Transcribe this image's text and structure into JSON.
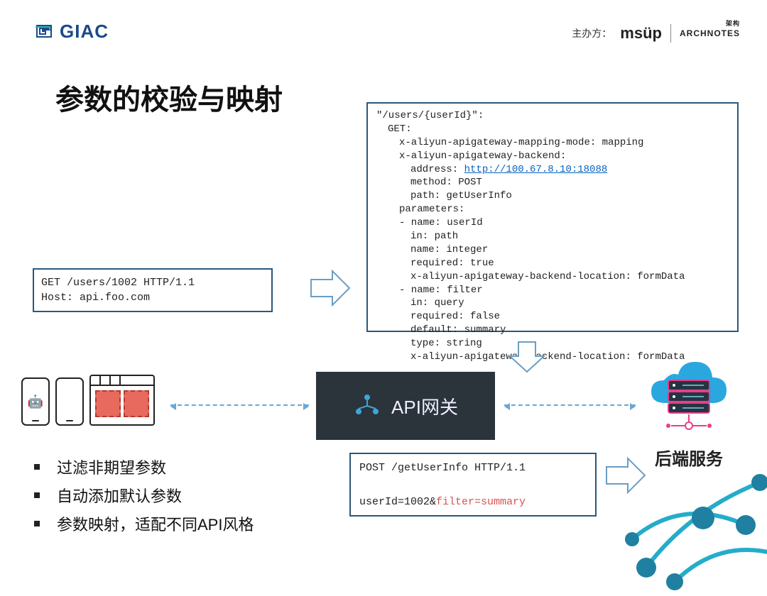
{
  "header": {
    "logo_text": "GIAC",
    "host_label": "主办方：",
    "sponsor1": "msüp",
    "sponsor2": "ARCHNOTES"
  },
  "title": "参数的校验与映射",
  "request_box": {
    "line1": "GET /users/1002 HTTP/1.1",
    "line2": "Host: api.foo.com"
  },
  "config_box": {
    "path_decl": "\"/users/{userId}\":",
    "method": "GET:",
    "mapping_mode": "x-aliyun-apigateway-mapping-mode: mapping",
    "backend_key": "x-aliyun-apigateway-backend:",
    "address_label": "address: ",
    "address_url": "http://100.67.8.10:18088",
    "backend_method": "method: POST",
    "backend_path": "path: getUserInfo",
    "params_key": "parameters:",
    "p1_name": "- name: userId",
    "p1_in": "in: path",
    "p1_type": "name: integer",
    "p1_required": "required: true",
    "p1_loc": "x-aliyun-apigateway-backend-location: formData",
    "p2_name": "- name: filter",
    "p2_in": "in: query",
    "p2_required": "required: false",
    "p2_default": "default: summary",
    "p2_type": "type: string",
    "p2_loc": "x-aliyun-apigateway-backend-location: formData"
  },
  "gateway_label": "API网关",
  "backend_label": "后端服务",
  "response_box": {
    "line1": "POST /getUserInfo HTTP/1.1",
    "line2a": "userId=1002&",
    "line2b": "filter=summary"
  },
  "bullets": {
    "b1": "过滤非期望参数",
    "b2": "自动添加默认参数",
    "b3": "参数映射，适配不同API风格"
  },
  "icons": {
    "giac": "logo",
    "android": "android-icon",
    "apple": "apple-icon",
    "gateway": "network-node-icon",
    "cloud_server": "cloud-server-icon"
  }
}
